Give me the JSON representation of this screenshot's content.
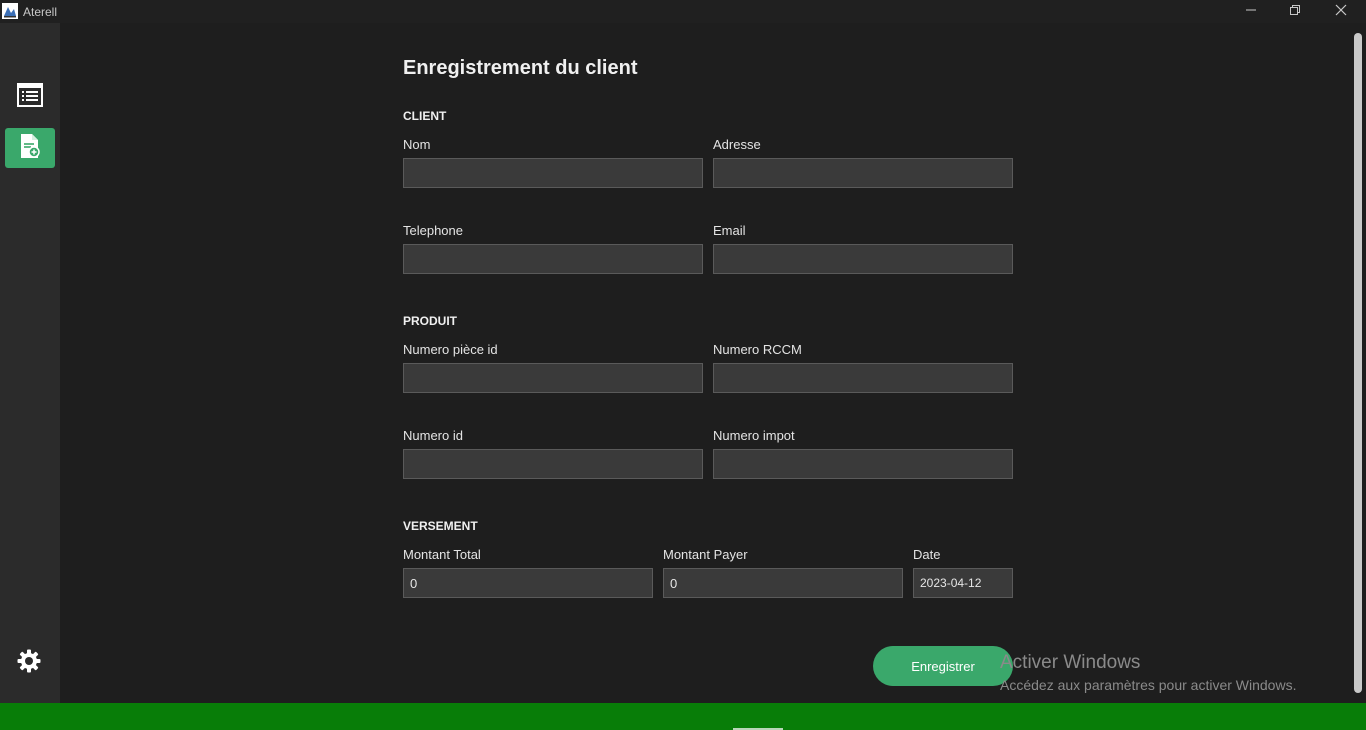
{
  "window": {
    "title": "Aterell",
    "controls": {
      "minimize_icon": "minimize-icon",
      "restore_icon": "restore-icon",
      "close_icon": "close-icon"
    }
  },
  "sidebar": {
    "items": [
      {
        "icon": "list-icon",
        "active": false
      },
      {
        "icon": "add-document-icon",
        "active": true
      }
    ],
    "settings_icon": "gear-icon"
  },
  "form": {
    "title": "Enregistrement du client",
    "sections": {
      "client": "CLIENT",
      "produit": "PRODUIT",
      "versement": "VERSEMENT"
    },
    "fields": {
      "nom": {
        "label": "Nom",
        "value": ""
      },
      "adresse": {
        "label": "Adresse",
        "value": ""
      },
      "telephone": {
        "label": "Telephone",
        "value": ""
      },
      "email": {
        "label": "Email",
        "value": ""
      },
      "numero_piece_id": {
        "label": "Numero pièce id",
        "value": ""
      },
      "numero_rccm": {
        "label": "Numero RCCM",
        "value": ""
      },
      "numero_id": {
        "label": "Numero id",
        "value": ""
      },
      "numero_impot": {
        "label": "Numero impot",
        "value": ""
      },
      "montant_total": {
        "label": "Montant Total",
        "value": "0"
      },
      "montant_payer": {
        "label": "Montant Payer",
        "value": "0"
      },
      "date": {
        "label": "Date",
        "value": "2023-04-12"
      }
    },
    "submit_label": "Enregistrer"
  },
  "watermark": {
    "title": "Activer Windows",
    "subtitle": "Accédez aux paramètres pour activer Windows."
  },
  "colors": {
    "accent": "#3aa86b",
    "statusbar": "#087d08",
    "background": "#1e1e1e",
    "sidebar": "#2b2b2b"
  }
}
